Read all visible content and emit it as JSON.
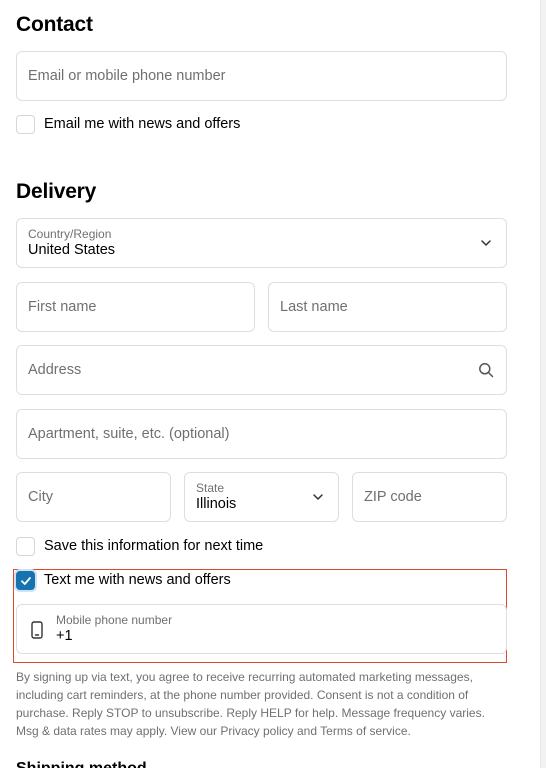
{
  "contact": {
    "title": "Contact",
    "email_placeholder": "Email or mobile phone number",
    "email_news_label": "Email me with news and offers",
    "email_news_checked": false
  },
  "delivery": {
    "title": "Delivery",
    "country_label": "Country/Region",
    "country_value": "United States",
    "first_name_placeholder": "First name",
    "last_name_placeholder": "Last name",
    "address_placeholder": "Address",
    "apartment_placeholder": "Apartment, suite, etc. (optional)",
    "city_placeholder": "City",
    "state_label": "State",
    "state_value": "Illinois",
    "zip_placeholder": "ZIP code",
    "save_info_label": "Save this information for next time",
    "save_info_checked": false,
    "text_news_label": "Text me with news and offers",
    "text_news_checked": true,
    "phone_label": "Mobile phone number",
    "phone_value": "+1"
  },
  "consent_text": "By signing up via text, you agree to receive recurring automated marketing messages, including cart reminders, at the phone number provided. Consent is not a condition of purchase. Reply STOP to unsubscribe. Reply HELP for help. Message frequency varies. Msg & data rates may apply. View our Privacy policy and Terms of service.",
  "next_section_title": "Shipping method",
  "icons": {
    "country_chevron": "chevron-down-icon",
    "address_search": "search-icon",
    "state_chevron": "chevron-down-icon",
    "phone": "mobile-phone-icon",
    "checkmark": "checkmark-icon"
  },
  "colors": {
    "accent": "#1773b0",
    "highlight": "#e4462b",
    "border": "#dedede",
    "muted_text": "#707070"
  }
}
